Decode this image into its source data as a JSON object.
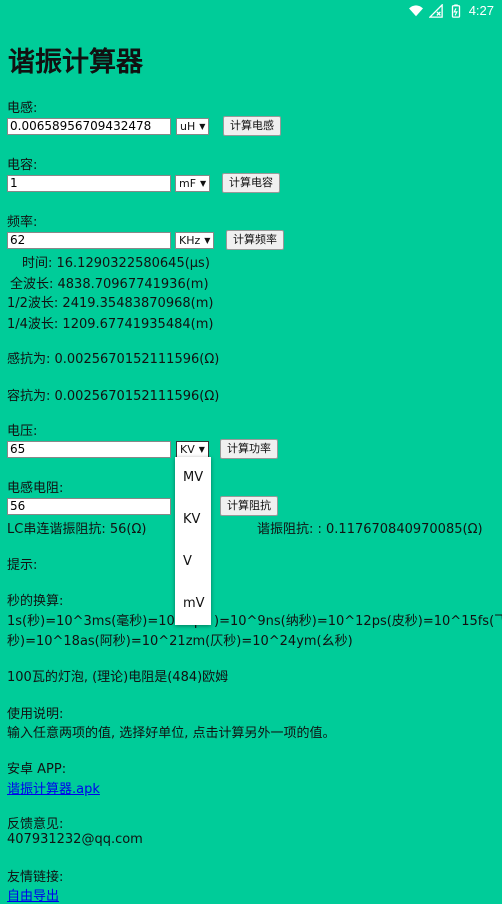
{
  "status": {
    "time": "4:27"
  },
  "title": "谐振计算器",
  "inductance": {
    "label": "电感:",
    "value": "0.00658956709432478",
    "unit": "uH",
    "button": "计算电感"
  },
  "capacitance": {
    "label": "电容:",
    "value": "1",
    "unit": "mF",
    "button": "计算电容"
  },
  "frequency": {
    "label": "频率:",
    "value": "62",
    "unit": "KHz",
    "button": "计算频率",
    "time": "时间: 16.1290322580645(μs)",
    "wave": "全波长: 4838.70967741936(m)",
    "half": "1/2波长: 2419.35483870968(m)",
    "quarter": "1/4波长: 1209.67741935484(m)"
  },
  "reactance": {
    "inductive": "感抗为: 0.0025670152111596(Ω)",
    "capacitive": "容抗为: 0.0025670152111596(Ω)"
  },
  "voltage": {
    "label": "电压:",
    "value": "65",
    "unit": "KV",
    "button": "计算功率"
  },
  "resistance": {
    "label": "电感电阻:",
    "value": "56",
    "button": "计算阻抗"
  },
  "lc_line_left": "LC串连谐振阻抗: 56(Ω)",
  "lc_line_right": "谐振阻抗: : 0.117670840970085(Ω)",
  "lc_line_mid": "L",
  "dropdown": [
    "MV",
    "KV",
    "V",
    "mV"
  ],
  "tips": "提示:",
  "seconds_title": "秒的换算:",
  "seconds_line1": "1s(秒)=10^3ms(毫秒)=10^6μ",
  "seconds_line1b": ")=10^9ns(纳秒)=10^12ps(皮秒)=10^15fs(飞",
  "seconds_line2": "秒)=10^18as(阿秒)=10^21zm(仄秒)=10^24ym(幺秒)",
  "bulb": "100瓦的灯泡, (理论)电阻是(484)欧姆",
  "usage_title": "使用说明:",
  "usage_text": "输入任意两项的值, 选择好单位, 点击计算另外一项的值。",
  "app_title": "安卓 APP:",
  "app_link": "谐振计算器.apk",
  "feedback_title": "反馈意见:",
  "feedback_email": "407931232@qq.com",
  "links_title": "友情链接:",
  "links_item": "自由导出"
}
